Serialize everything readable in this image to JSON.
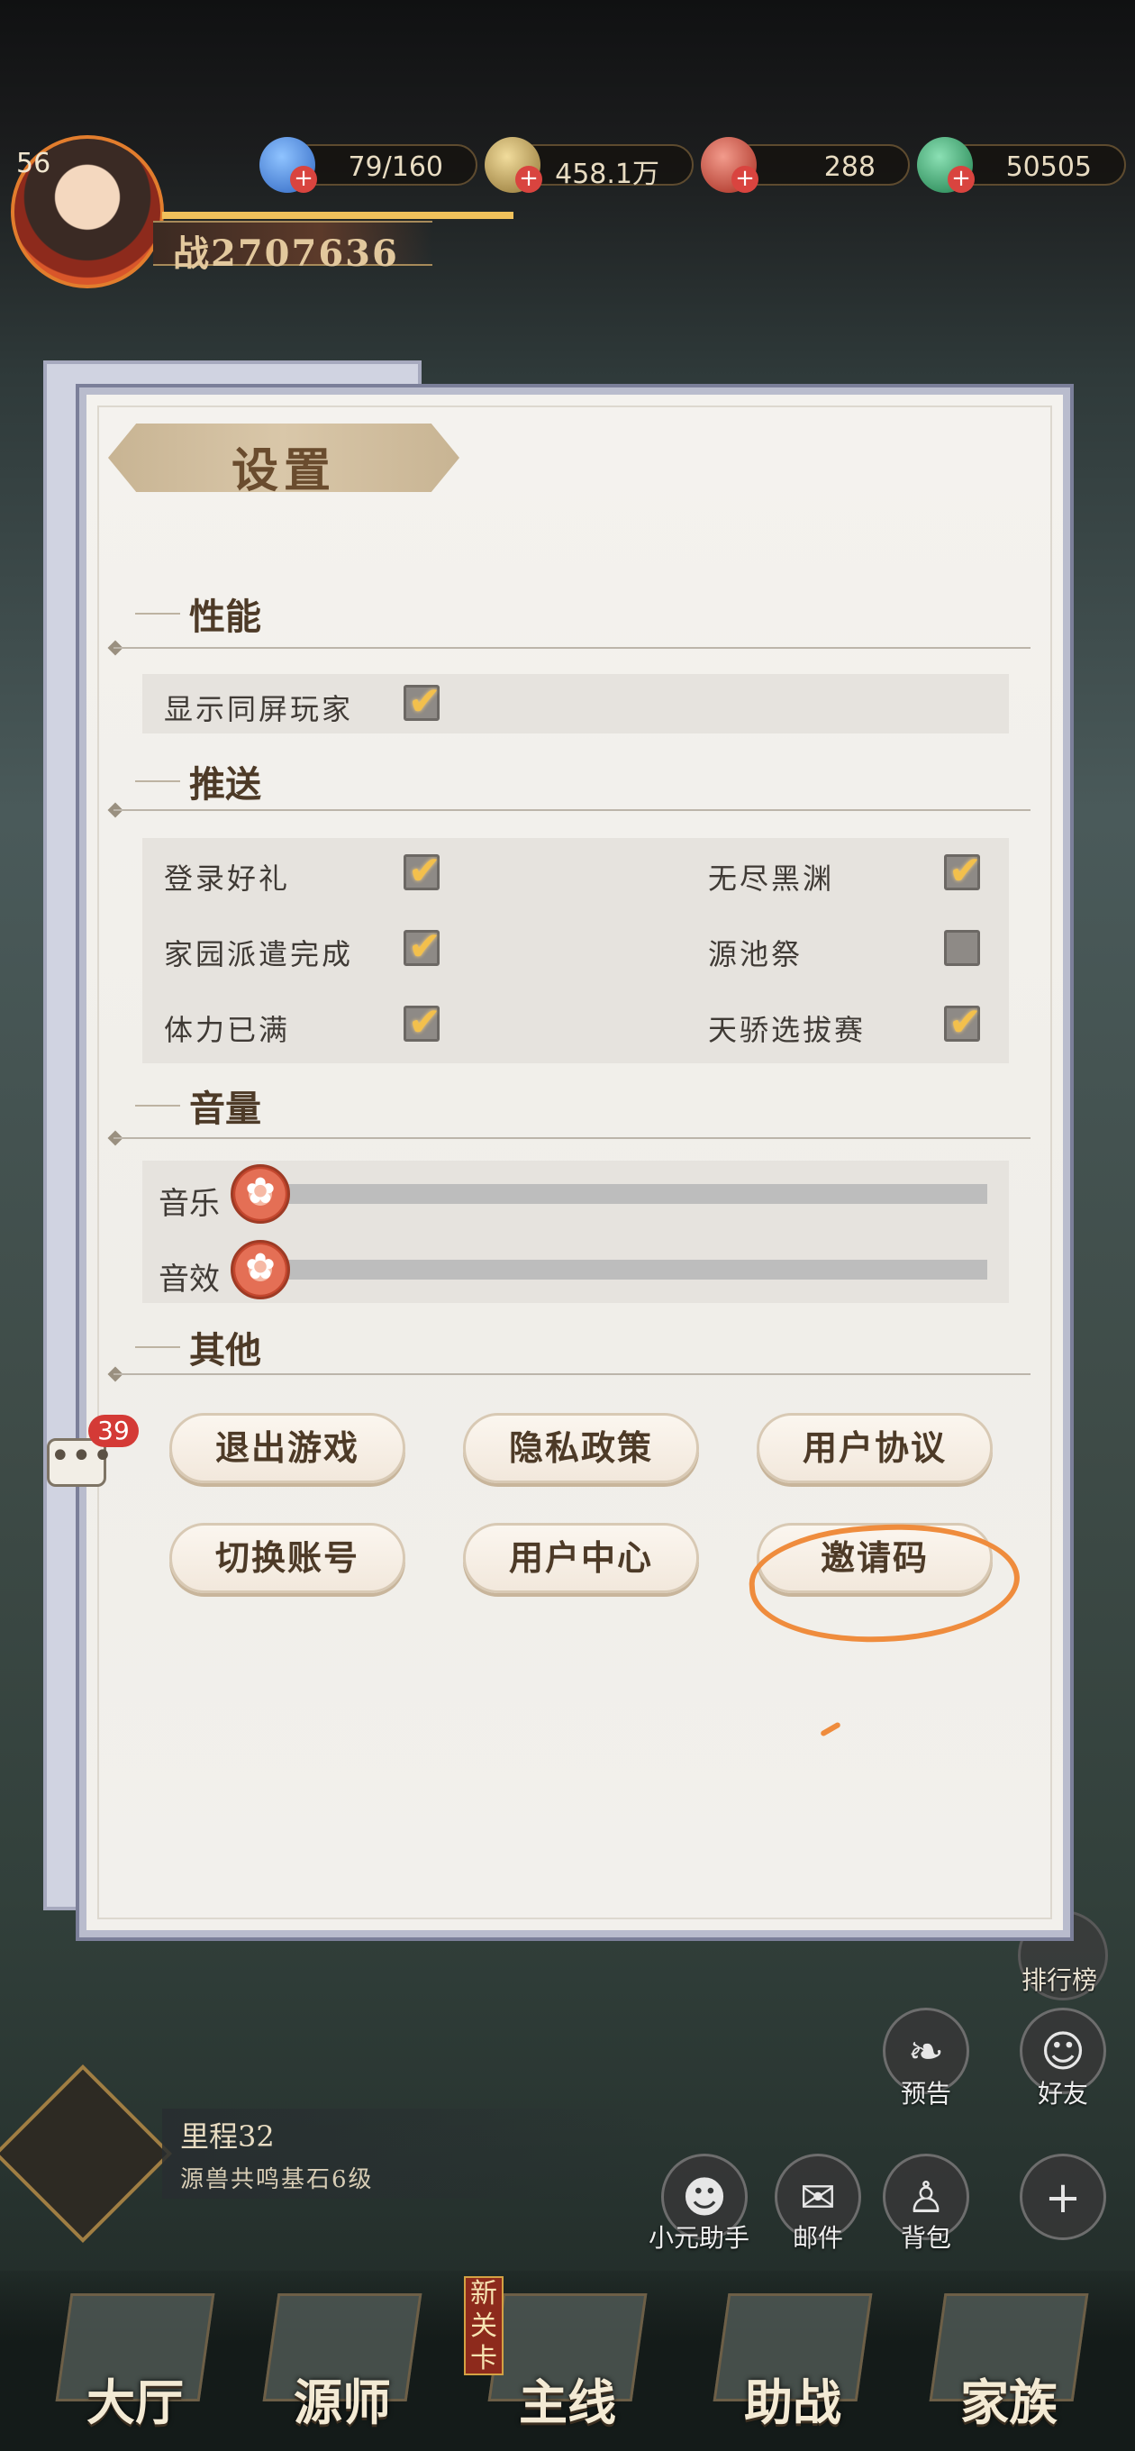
{
  "player": {
    "level": "56",
    "power": "战2707636"
  },
  "resources": [
    {
      "name": "stamina",
      "value": "79/160",
      "icon": "water-drop-icon",
      "color": "#3d7bd9"
    },
    {
      "name": "coins",
      "value": "458.1万",
      "icon": "coin-icon",
      "color": "#c9a64b"
    },
    {
      "name": "gems",
      "value": "288",
      "icon": "red-gem-icon",
      "color": "#d44535"
    },
    {
      "name": "jade",
      "value": "50505",
      "icon": "green-jade-icon",
      "color": "#2fae6b"
    }
  ],
  "settings": {
    "title": "设置",
    "performance": {
      "heading": "性能",
      "items": [
        {
          "label": "显示同屏玩家",
          "checked": true
        }
      ]
    },
    "push": {
      "heading": "推送",
      "items": [
        {
          "label": "登录好礼",
          "checked": true
        },
        {
          "label": "无尽黑渊",
          "checked": true
        },
        {
          "label": "家园派遣完成",
          "checked": true
        },
        {
          "label": "源池祭",
          "checked": false
        },
        {
          "label": "体力已满",
          "checked": true
        },
        {
          "label": "天骄选拔赛",
          "checked": true
        }
      ]
    },
    "volume": {
      "heading": "音量",
      "music_label": "音乐",
      "sfx_label": "音效",
      "music_level": 0,
      "sfx_level": 0
    },
    "other": {
      "heading": "其他",
      "buttons": [
        "退出游戏",
        "隐私政策",
        "用户协议",
        "切换账号",
        "用户中心",
        "邀请码"
      ]
    }
  },
  "chat": {
    "badge_count": "39",
    "icon": "chat-bubble-icon"
  },
  "side_menu": {
    "ranking": "排行榜",
    "preview": "预告",
    "friends": "好友",
    "assistant": "小元助手",
    "mail": "邮件",
    "bag": "背包"
  },
  "quest": {
    "title": "里程32",
    "desc": "源兽共鸣基石6级"
  },
  "nav": {
    "tabs": [
      "大厅",
      "源师",
      "主线",
      "助战",
      "家族"
    ],
    "new_tag": "新关卡"
  },
  "annotation_color": "#ef8c3d"
}
